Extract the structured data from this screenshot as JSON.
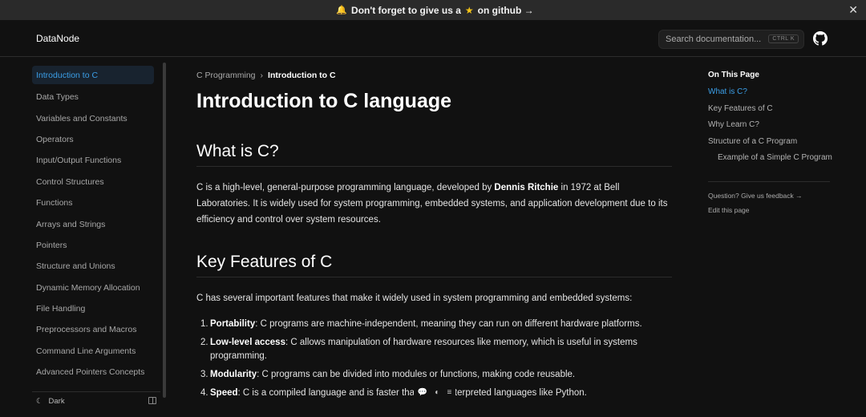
{
  "banner": {
    "text_before": "Don't forget to give us a",
    "text_after": "on github →"
  },
  "navbar": {
    "logo": "DataNode",
    "search_placeholder": "Search documentation...",
    "search_shortcut": "CTRL K"
  },
  "sidebar": {
    "items": [
      {
        "label": "Introduction to C",
        "active": true
      },
      {
        "label": "Data Types"
      },
      {
        "label": "Variables and Constants"
      },
      {
        "label": "Operators"
      },
      {
        "label": "Input/Output Functions"
      },
      {
        "label": "Control Structures"
      },
      {
        "label": "Functions"
      },
      {
        "label": "Arrays and Strings"
      },
      {
        "label": "Pointers"
      },
      {
        "label": "Structure and Unions"
      },
      {
        "label": "Dynamic Memory Allocation"
      },
      {
        "label": "File Handling"
      },
      {
        "label": "Preprocessors and Macros"
      },
      {
        "label": "Command Line Arguments"
      },
      {
        "label": "Advanced Pointers Concepts"
      }
    ],
    "theme_label": "Dark"
  },
  "breadcrumb": {
    "parent": "C Programming",
    "current": "Introduction to C"
  },
  "main": {
    "title": "Introduction to C language",
    "section1": {
      "heading": "What is C?",
      "p_before": "C is a high-level, general-purpose programming language, developed by ",
      "p_bold": "Dennis Ritchie",
      "p_after": " in 1972 at Bell Laboratories. It is widely used for system programming, embedded systems, and application development due to its efficiency and control over system resources."
    },
    "section2": {
      "heading": "Key Features of C",
      "intro": "C has several important features that make it widely used in system programming and embedded systems:",
      "features": [
        {
          "num": "1.",
          "term": "Portability",
          "desc": ": C programs are machine-independent, meaning they can run on different hardware platforms."
        },
        {
          "num": "2.",
          "term": "Low-level access",
          "desc": ": C allows manipulation of hardware resources like memory, which is useful in systems programming."
        },
        {
          "num": "3.",
          "term": "Modularity",
          "desc": ": C programs can be divided into modules or functions, making code reusable."
        },
        {
          "num": "4.",
          "term": "Speed",
          "desc": ": C is a compiled language and is faster than many interpreted languages like Python."
        }
      ]
    }
  },
  "toc": {
    "title": "On This Page",
    "items": [
      {
        "label": "What is C?",
        "active": true
      },
      {
        "label": "Key Features of C"
      },
      {
        "label": "Why Learn C?"
      },
      {
        "label": "Structure of a C Program"
      },
      {
        "label": "Example of a Simple C Program",
        "sub": true
      }
    ],
    "feedback": "Question? Give us feedback →",
    "edit": "Edit this page"
  },
  "colors": {
    "accent": "#3b9fe8",
    "background": "#111111",
    "star": "#f5c518"
  }
}
